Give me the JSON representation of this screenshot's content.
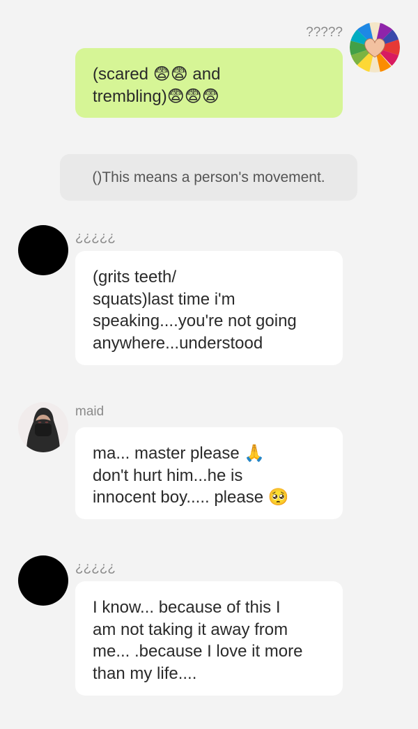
{
  "messages": [
    {
      "side": "right",
      "sender": "?????",
      "text": "(scared 😨😨 and\ntrembling)😨😨😨"
    },
    {
      "side": "system",
      "text": "()This means a person's movement."
    },
    {
      "side": "left",
      "sender": "¿¿¿¿¿",
      "text": "(grits teeth/\nsquats)last time i'm\nspeaking....you're not going\nanywhere...understood"
    },
    {
      "side": "left",
      "sender": "maid",
      "text": "ma... master please 🙏\ndon't hurt him...he is\ninnocent boy..... please 🥺"
    },
    {
      "side": "left",
      "sender": "¿¿¿¿¿",
      "text": "I know... because of this I\nam not taking it away from\nme... .because I love it more\nthan my life...."
    }
  ],
  "colors": {
    "background": "#f3f3f3",
    "outgoing_bubble": "#d6f596",
    "incoming_bubble": "#ffffff",
    "system_notice": "#e9e9e9"
  },
  "icons": {
    "sender_avatar": "pencils-heart-avatar",
    "maid_avatar": "hijab-woman-avatar"
  }
}
